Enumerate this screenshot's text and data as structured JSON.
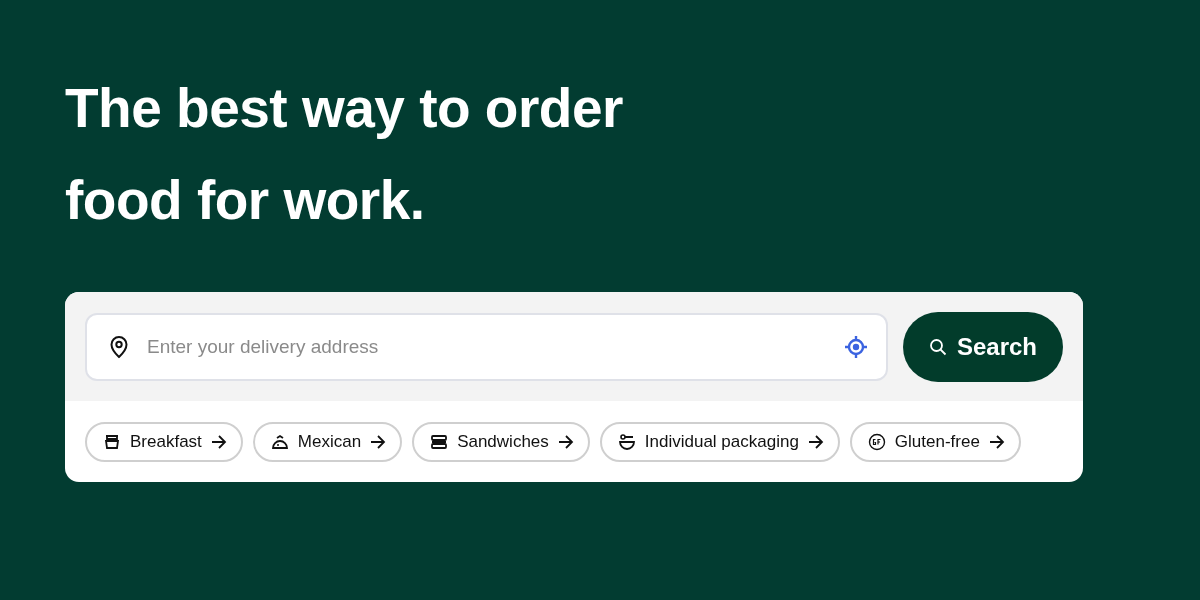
{
  "headline": [
    "The best way to order",
    "food for work."
  ],
  "search": {
    "placeholder": "Enter your delivery address",
    "button": "Search"
  },
  "chips": [
    {
      "label": "Breakfast"
    },
    {
      "label": "Mexican"
    },
    {
      "label": "Sandwiches"
    },
    {
      "label": "Individual packaging"
    },
    {
      "label": "Gluten-free"
    }
  ]
}
